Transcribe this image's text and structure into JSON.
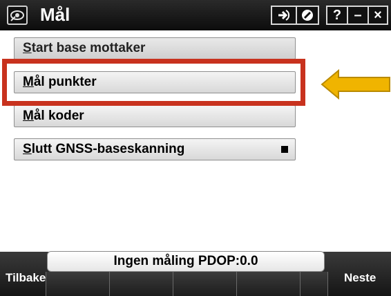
{
  "window": {
    "title": "Mål",
    "buttons": {
      "export_icon": "arrow-right-icon",
      "cancel_icon": "prohibit-icon",
      "help": "?",
      "minimize": "–",
      "close": "×"
    }
  },
  "menu": {
    "items": [
      {
        "label_underline": "S",
        "label_rest": "tart base mottaker"
      },
      {
        "label_underline": "M",
        "label_rest": "ål punkter"
      },
      {
        "label_underline": "M",
        "label_rest": "ål koder"
      },
      {
        "label_underline": "S",
        "label_rest": "lutt GNSS-baseskanning"
      }
    ]
  },
  "status": {
    "text": "Ingen måling  PDOP:0.0"
  },
  "softkeys": {
    "back": "Tilbake",
    "next": "Neste"
  },
  "colors": {
    "highlight": "#c8321e",
    "arrow": "#f0b400"
  }
}
